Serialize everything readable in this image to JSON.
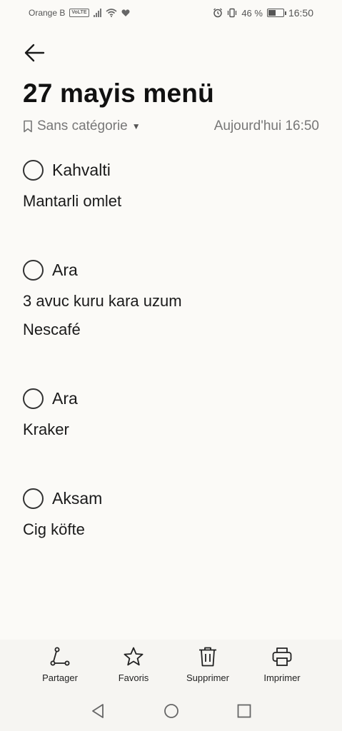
{
  "status_bar": {
    "carrier": "Orange B",
    "volte": "VoLTE",
    "battery": "46 %",
    "battery_level": 0.46,
    "time": "16:50"
  },
  "note": {
    "title": "27 mayis menü",
    "category": "Sans catégorie",
    "timestamp": "Aujourd'hui 16:50"
  },
  "content": {
    "block1": {
      "check": "Kahvalti",
      "lines": [
        "Mantarli omlet"
      ]
    },
    "block2": {
      "check": "Ara",
      "lines": [
        "3 avuc kuru kara uzum",
        "Nescafé"
      ]
    },
    "block3": {
      "check": "Ara",
      "lines": [
        "Kraker"
      ]
    },
    "block4": {
      "check": "Aksam",
      "lines": [
        "Cig köfte"
      ]
    }
  },
  "toolbar": {
    "share": "Partager",
    "favorites": "Favoris",
    "delete": "Supprimer",
    "print": "Imprimer"
  },
  "icons": {
    "back": "arrow-left-icon",
    "category": "bookmark-icon",
    "share": "share-icon",
    "favorites": "star-icon",
    "delete": "trash-icon",
    "print": "printer-icon",
    "nav_back": "triangle-back-icon",
    "nav_home": "circle-home-icon",
    "nav_recent": "square-recent-icon"
  }
}
